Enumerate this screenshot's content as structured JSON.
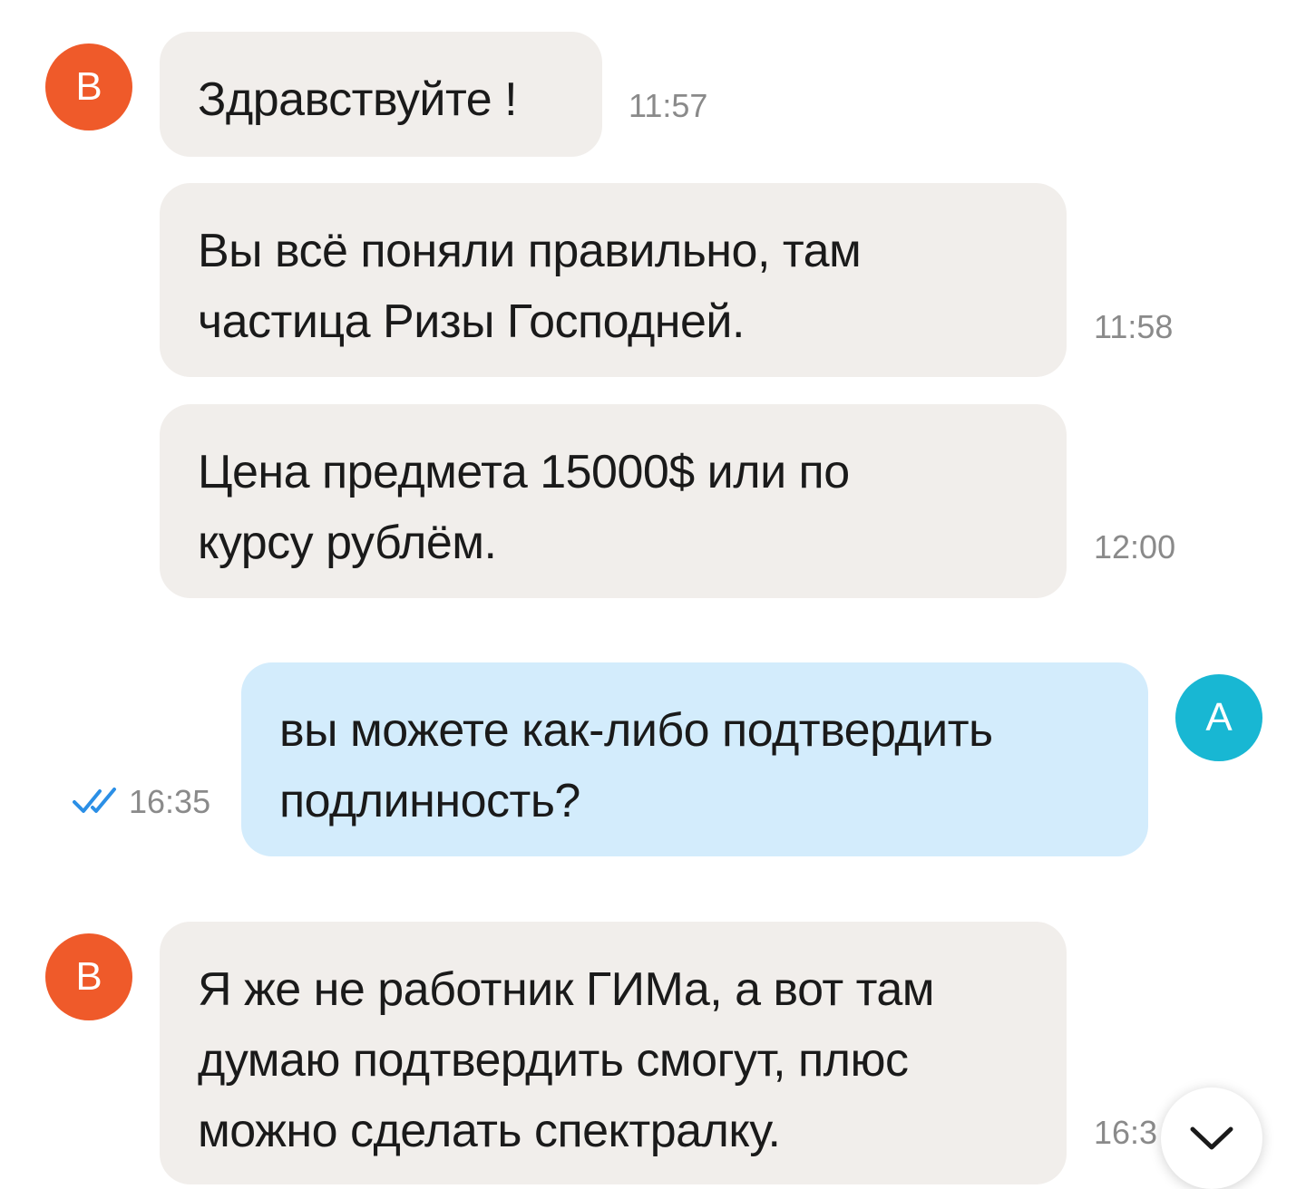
{
  "chat": {
    "messages": [
      {
        "direction": "in",
        "avatar_letter": "B",
        "text": "Здравствуйте !",
        "time": "11:57"
      },
      {
        "direction": "in",
        "text": "Вы всё поняли правильно, там\nчастица Ризы Господней.",
        "time": "11:58"
      },
      {
        "direction": "in",
        "text": "Цена предмета 15000$ или по\nкурсу рублём.",
        "time": "12:00"
      },
      {
        "direction": "out",
        "avatar_letter": "A",
        "text": "вы можете как-либо подтвердить\nподлинность?",
        "time": "16:35",
        "status": "read"
      },
      {
        "direction": "in",
        "avatar_letter": "B",
        "text": "Я же не работник ГИМа, а вот там\nдумаю подтвердить смогут, плюс\nможно сделать спектралку.",
        "time": "16:3"
      }
    ]
  },
  "colors": {
    "seller_avatar": "#ef5a2a",
    "my_avatar": "#18b7d3",
    "incoming_bubble": "#f1eeeb",
    "outgoing_bubble": "#d3ecfc",
    "read_check": "#2b8fe6"
  },
  "icons": {
    "read_receipt": "double-check-icon",
    "scroll_down": "chevron-down-icon"
  }
}
